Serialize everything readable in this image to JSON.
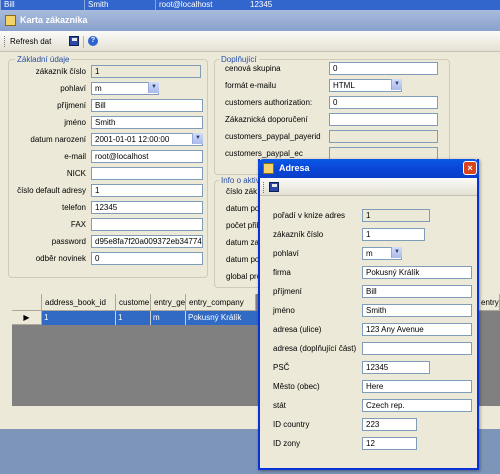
{
  "top_row": [
    "Bill",
    "Smith",
    "root@localhost",
    "12345"
  ],
  "window": {
    "title": "Karta zákazníka"
  },
  "toolbar": {
    "refresh_label": "Refresh dat"
  },
  "zakladni": {
    "title": "Základní údaje",
    "fields": [
      {
        "label": "zákazník číslo",
        "value": "1"
      },
      {
        "label": "pohlaví",
        "value": "m"
      },
      {
        "label": "příjmení",
        "value": "Bill"
      },
      {
        "label": "jméno",
        "value": "Smith"
      },
      {
        "label": "datum narození",
        "value": "2001-01-01 12:00:00"
      },
      {
        "label": "e-mail",
        "value": "root@localhost"
      },
      {
        "label": "NICK",
        "value": ""
      },
      {
        "label": "číslo default adresy",
        "value": "1"
      },
      {
        "label": "telefon",
        "value": "12345"
      },
      {
        "label": "FAX",
        "value": ""
      },
      {
        "label": "password",
        "value": "d95e8fa7f20a009372eb34774"
      },
      {
        "label": "odběr novinek",
        "value": "0"
      }
    ]
  },
  "doplnujici": {
    "title": "Doplňující",
    "fields": [
      {
        "label": "cenová skupina",
        "value": "0"
      },
      {
        "label": "formát e-mailu",
        "value": "HTML"
      },
      {
        "label": "customers authorization:",
        "value": "0"
      },
      {
        "label": "Zákaznická doporučení",
        "value": ""
      },
      {
        "label": "customers_paypal_payerid",
        "value": ""
      },
      {
        "label": "customers_paypal_ec",
        "value": ""
      }
    ]
  },
  "info": {
    "title": "Info o aktiv",
    "labels": [
      "číslo zák",
      "datum po",
      "počet přih",
      "datum zal",
      "datum po",
      "global pro"
    ]
  },
  "grid": {
    "columns": [
      "address_book_id",
      "custome",
      "entry_ge",
      "entry_company",
      "entry_"
    ],
    "row": [
      "1",
      "1",
      "m",
      "Pokusný Králík"
    ]
  },
  "adresa": {
    "title": "Adresa",
    "close": "×",
    "fields": [
      {
        "label": "pořadí v knize adres",
        "value": "1"
      },
      {
        "label": "zákazník číslo",
        "value": "1"
      },
      {
        "label": "pohlaví",
        "value": "m"
      },
      {
        "label": "firma",
        "value": "Pokusný Králík"
      },
      {
        "label": "příjmení",
        "value": "Bill"
      },
      {
        "label": "jméno",
        "value": "Smith"
      },
      {
        "label": "adresa (ulice)",
        "value": "123 Any Avenue"
      },
      {
        "label": "adresa (doplňující část)",
        "value": ""
      },
      {
        "label": "PSČ",
        "value": "12345"
      },
      {
        "label": "Město (obec)",
        "value": "Here"
      },
      {
        "label": "stát",
        "value": "Czech rep."
      },
      {
        "label": "ID country",
        "value": "223"
      },
      {
        "label": "ID zony",
        "value": "12"
      }
    ]
  },
  "icons": [
    "app-icon",
    "save-icon",
    "help-icon",
    "dropdown-arrow-icon",
    "row-pointer-icon",
    "close-icon"
  ]
}
